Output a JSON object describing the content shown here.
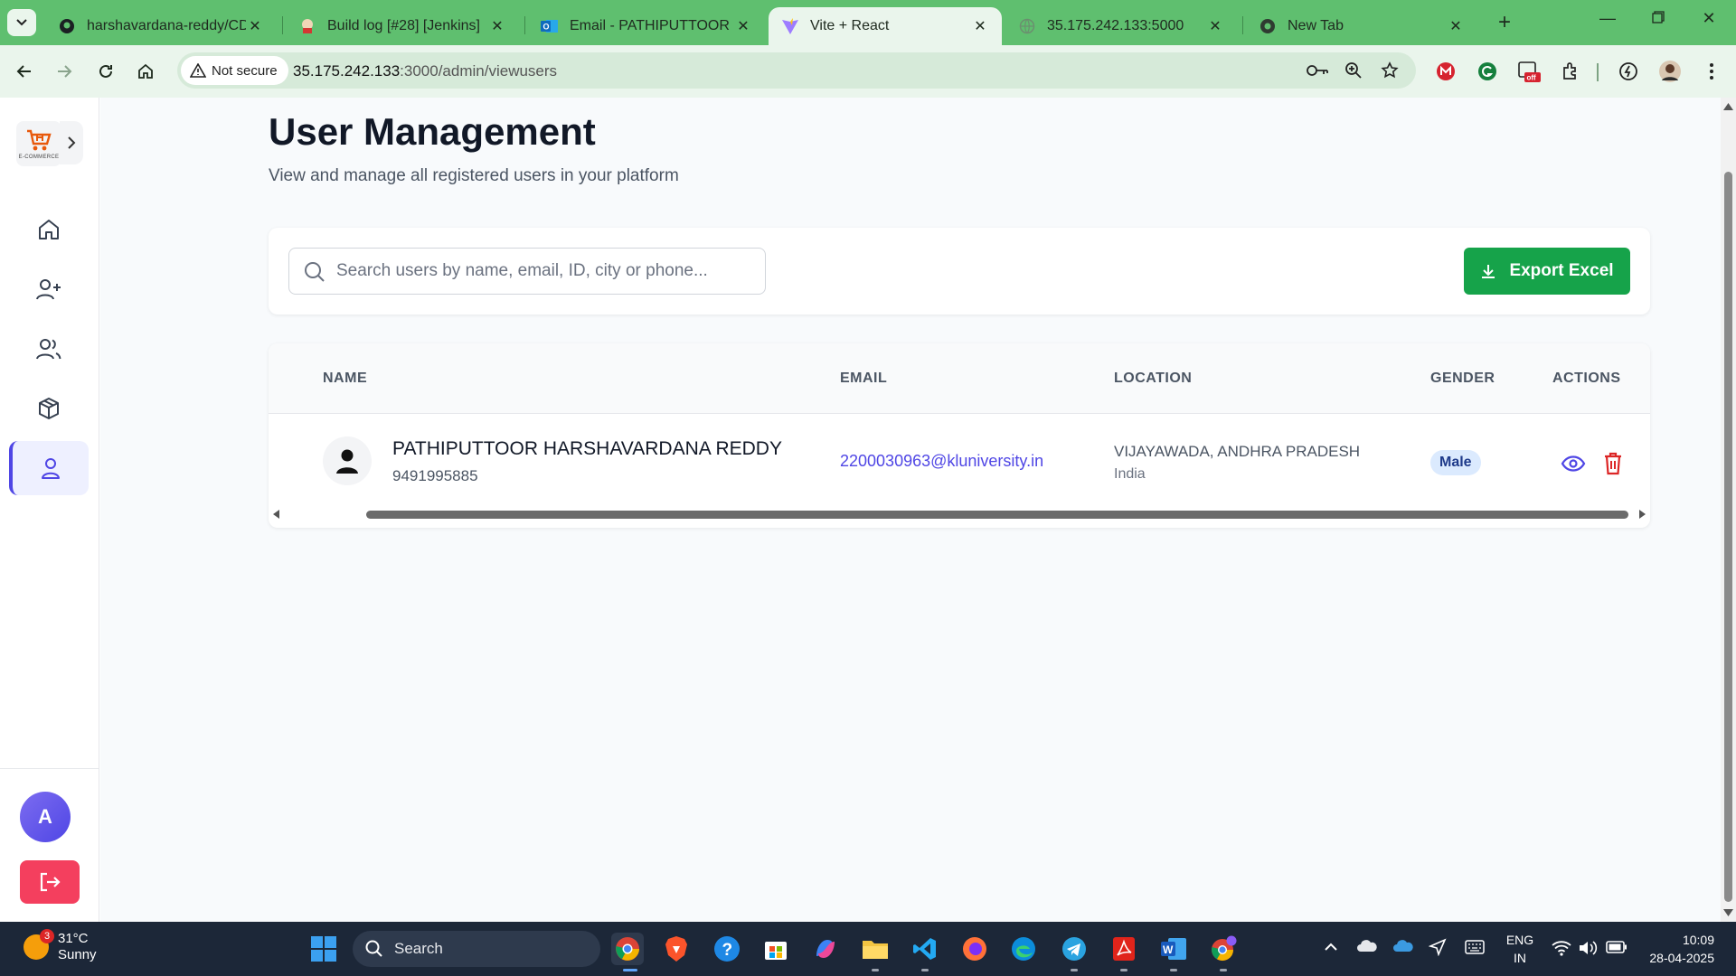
{
  "browser": {
    "tabs": [
      {
        "title": "harshavardana-reddy/CD_I",
        "icon": "github-icon",
        "active": false
      },
      {
        "title": "Build log [#28] [Jenkins]",
        "icon": "jenkins-icon",
        "active": false
      },
      {
        "title": "Email - PATHIPUTTOOR HA",
        "icon": "outlook-icon",
        "active": false
      },
      {
        "title": "Vite + React",
        "icon": "vite-icon",
        "active": true
      },
      {
        "title": "35.175.242.133:5000",
        "icon": "globe-icon",
        "active": false
      },
      {
        "title": "New Tab",
        "icon": "chrome-icon",
        "active": false
      }
    ],
    "security_label": "Not secure",
    "url_host": "35.175.242.133",
    "url_path": ":3000/admin/viewusers"
  },
  "sidebar": {
    "logo_text": "E-COMMERCE",
    "nav": [
      {
        "icon": "home-icon",
        "active": false
      },
      {
        "icon": "add-user-icon",
        "active": false
      },
      {
        "icon": "users-icon",
        "active": false
      },
      {
        "icon": "package-icon",
        "active": false
      },
      {
        "icon": "user-icon",
        "active": true
      }
    ],
    "avatar_letter": "A"
  },
  "page": {
    "title": "User Management",
    "subtitle": "View and manage all registered users in your platform"
  },
  "search": {
    "placeholder": "Search users by name, email, ID, city or phone...",
    "value": ""
  },
  "export_label": "Export Excel",
  "table": {
    "headers": [
      "NAME",
      "EMAIL",
      "LOCATION",
      "GENDER",
      "ACTIONS"
    ],
    "rows": [
      {
        "name": "PATHIPUTTOOR HARSHAVARDANA REDDY",
        "phone": "9491995885",
        "email": "2200030963@kluniversity.in",
        "city": "VIJAYAWADA, ANDHRA PRADESH",
        "country": "India",
        "gender": "Male"
      }
    ]
  },
  "taskbar": {
    "weather_temp": "31°C",
    "weather_desc": "Sunny",
    "weather_badge": "3",
    "search_label": "Search",
    "lang_line1": "ENG",
    "lang_line2": "IN",
    "time": "10:09",
    "date": "28-04-2025"
  },
  "colors": {
    "accent": "#4f46e5",
    "export_green": "#16a34a",
    "logout_red": "#f43f5e",
    "chrome_green": "#5fbf6f"
  }
}
